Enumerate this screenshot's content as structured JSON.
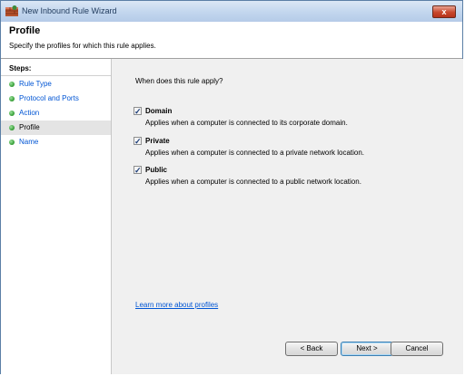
{
  "window": {
    "title": "New Inbound Rule Wizard",
    "close_label": "x"
  },
  "header": {
    "title": "Profile",
    "subtitle": "Specify the profiles for which this rule applies."
  },
  "steps": {
    "title": "Steps:",
    "items": [
      {
        "label": "Rule Type",
        "state": "done"
      },
      {
        "label": "Protocol and Ports",
        "state": "done"
      },
      {
        "label": "Action",
        "state": "done"
      },
      {
        "label": "Profile",
        "state": "current"
      },
      {
        "label": "Name",
        "state": "pending"
      }
    ]
  },
  "main": {
    "question": "When does this rule apply?",
    "options": [
      {
        "label": "Domain",
        "description": "Applies when a computer is connected to its corporate domain.",
        "checked": true
      },
      {
        "label": "Private",
        "description": "Applies when a computer is connected to a private network location.",
        "checked": true
      },
      {
        "label": "Public",
        "description": "Applies when a computer is connected to a public network location.",
        "checked": true
      }
    ],
    "learn_more": "Learn more about profiles"
  },
  "buttons": {
    "back": "< Back",
    "next": "Next >",
    "cancel": "Cancel"
  },
  "colors": {
    "link": "#0055d4",
    "step_bullet": "#2f9a2f",
    "current_step_bg": "#e4e4e4"
  }
}
